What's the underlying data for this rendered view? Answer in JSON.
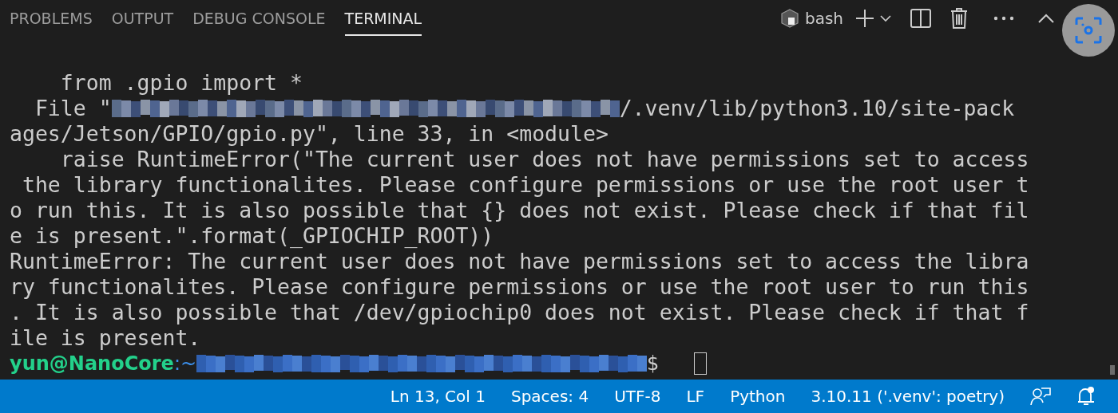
{
  "tabs": [
    {
      "label": "PROBLEMS",
      "selected": false
    },
    {
      "label": "OUTPUT",
      "selected": false
    },
    {
      "label": "DEBUG CONSOLE",
      "selected": false
    },
    {
      "label": "TERMINAL",
      "selected": true
    }
  ],
  "toolbar": {
    "shell": "bash"
  },
  "terminal": {
    "lines": [
      [
        {
          "kind": "text",
          "text": "    from .gpio import *"
        }
      ],
      [
        {
          "kind": "text",
          "text": "  File \""
        },
        {
          "kind": "redacted"
        },
        {
          "kind": "text",
          "text": "/.venv/lib/python3.10/site-pack"
        }
      ],
      [
        {
          "kind": "text",
          "text": "ages/Jetson/GPIO/gpio.py\", line 33, in <module>"
        }
      ],
      [
        {
          "kind": "text",
          "text": "    raise RuntimeError(\"The current user does not have permissions set to access"
        }
      ],
      [
        {
          "kind": "text",
          "text": " the library functionalites. Please configure permissions or use the root user t"
        }
      ],
      [
        {
          "kind": "text",
          "text": "o run this. It is also possible that {} does not exist. Please check if that fil"
        }
      ],
      [
        {
          "kind": "text",
          "text": "e is present.\".format(_GPIOCHIP_ROOT))"
        }
      ],
      [
        {
          "kind": "text",
          "text": "RuntimeError: The current user does not have permissions set to access the libra"
        }
      ],
      [
        {
          "kind": "text",
          "text": "ry functionalites. Please configure permissions or use the root user to run this"
        }
      ],
      [
        {
          "kind": "text",
          "text": ". It is also possible that /dev/gpiochip0 does not exist. Please check if that f"
        }
      ],
      [
        {
          "kind": "text",
          "text": "ile is present."
        }
      ]
    ],
    "prompt": {
      "user": "yun@NanoCore",
      "path": ":~",
      "symbol": "$"
    }
  },
  "status_bar": [
    "Ln 13, Col 1",
    "Spaces: 4",
    "UTF-8",
    "LF",
    "Python",
    "3.10.11 ('.venv': poetry)"
  ]
}
